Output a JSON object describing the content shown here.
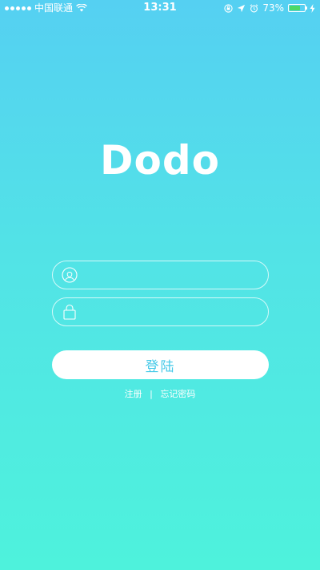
{
  "status_bar": {
    "carrier": "中国联通",
    "time": "13:31",
    "battery_percent_label": "73%",
    "battery_level": 0.73,
    "signal_bars": 5,
    "icons": [
      "wifi-icon",
      "rotation-lock-icon",
      "location-arrow-icon",
      "alarm-icon",
      "battery-icon",
      "charging-bolt-icon"
    ]
  },
  "logo": {
    "text": "Dodo"
  },
  "login_form": {
    "username": {
      "icon": "user-icon",
      "value": "",
      "placeholder": ""
    },
    "password": {
      "icon": "lock-icon",
      "value": "",
      "placeholder": ""
    },
    "submit_label": "登陆"
  },
  "links": {
    "register_label": "注册",
    "separator": "|",
    "forgot_password_label": "忘记密码"
  },
  "colors": {
    "gradient_top": "#55d0f2",
    "gradient_bottom": "#4ef2dc",
    "button_text": "#45c9e8",
    "battery_fill": "#4cd964"
  }
}
